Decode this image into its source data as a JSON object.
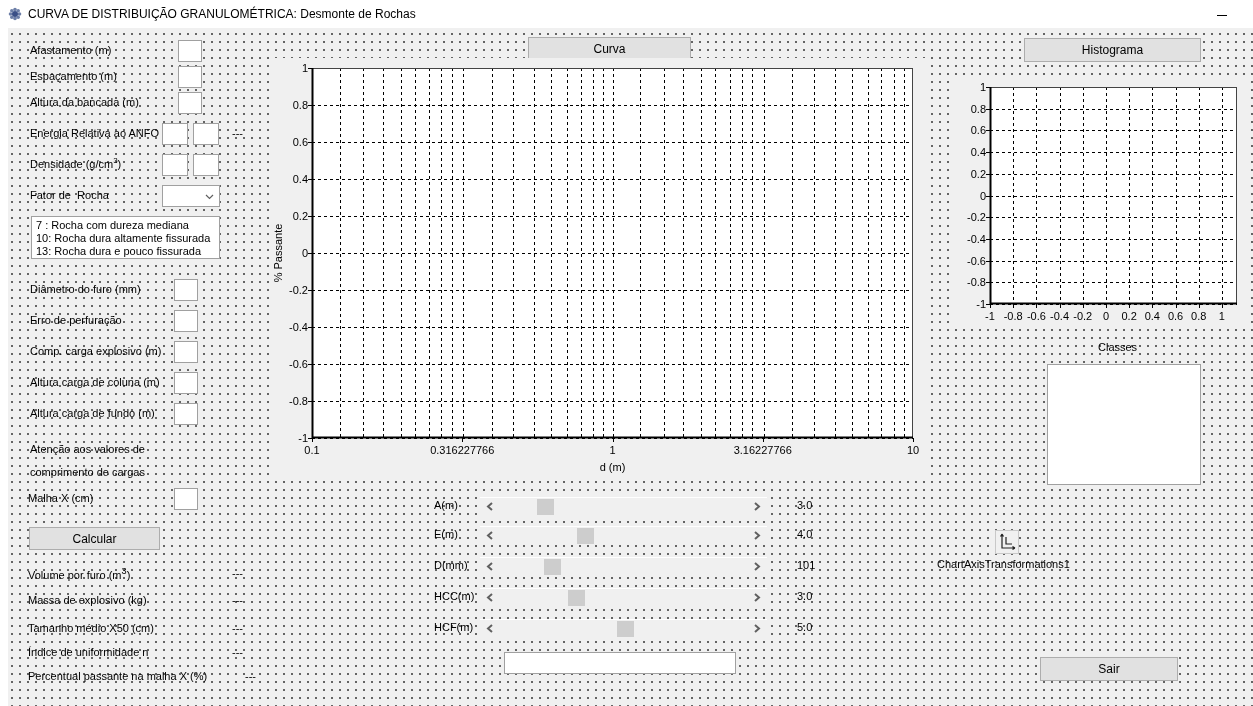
{
  "window": {
    "title": "CURVA DE DISTRIBUIÇÃO GRANULOMÉTRICA: Desmonte de Rochas"
  },
  "inputs": [
    {
      "kind": "single",
      "label": "Afastamento (m)"
    },
    {
      "kind": "single",
      "label": "Espaçamento (m)"
    },
    {
      "kind": "single",
      "label": "Altura da bancada (m)"
    },
    {
      "kind": "double",
      "label": "Energia Relativa ao ANFO",
      "suffix": "---"
    },
    {
      "kind": "double",
      "label": "Densidade (g/cm$^{3}$)"
    },
    {
      "kind": "combo",
      "label": "Fator de  Rocha"
    }
  ],
  "rock_factor_notes": [
    "7 : Rocha com dureza mediana",
    "10: Rocha dura altamente fissurada",
    "13: Rocha dura e pouco fissurada"
  ],
  "charge_inputs": [
    {
      "label": "Diâmetro do furo (mm)"
    },
    {
      "label": "Erro de perfuração"
    },
    {
      "label": "Comp. carga explosivo (m)"
    },
    {
      "label": "Altura carga de coluna (m)"
    },
    {
      "label": "Altura carga de fundo (m)"
    }
  ],
  "warning": [
    "Atenção aos valores de",
    "comprimento de cargas"
  ],
  "mesh": {
    "label": "Malha X (cm)"
  },
  "calculate_button": "Calcular",
  "results": [
    {
      "label": "Volume por furo (m$^{3}$)",
      "value": "---"
    },
    {
      "label": "Massa de explosivo (kg)",
      "value": "---"
    },
    {
      "label": "Tamanho médio X50 (cm)",
      "value": "---"
    },
    {
      "label": "Índice de uniformidade n",
      "value": "---"
    },
    {
      "label": "Percentual passante na malha X (%)",
      "value": "---"
    }
  ],
  "curve_button": "Curva",
  "curve_chart": {
    "xlabel": "d (m)",
    "ylabel": "% Passante",
    "x_tick_labels": [
      "0.1",
      "0.316227766",
      "1",
      "3.16227766",
      "10"
    ],
    "y_tick_labels": [
      "1",
      "0.8",
      "0.6",
      "0.4",
      "0.2",
      "0",
      "-0.2",
      "-0.4",
      "-0.6",
      "-0.8",
      "-1"
    ]
  },
  "sliders": [
    {
      "label": "A(m)",
      "reading": "3.0"
    },
    {
      "label": "E(m)",
      "reading": "4.0"
    },
    {
      "label": "D(mm)",
      "reading": "101"
    },
    {
      "label": "HCC(m)",
      "reading": "3.0"
    },
    {
      "label": "HCF(m)",
      "reading": "5.0"
    }
  ],
  "histogram_button": "Histograma",
  "histogram_chart": {
    "chart_data": {
      "type": "bar",
      "grid": true,
      "xlim": [
        -1,
        1.13
      ],
      "ylim": [
        -1,
        1
      ],
      "xticks": [
        -1,
        -0.8,
        -0.6,
        -0.4,
        -0.2,
        0,
        0.2,
        0.4,
        0.6,
        0.8,
        1
      ],
      "yticks": [
        -1,
        -0.8,
        -0.6,
        -0.4,
        -0.2,
        0,
        0.2,
        0.4,
        0.6,
        0.8,
        1
      ]
    }
  },
  "classes": {
    "label": "Classes"
  },
  "component": {
    "name": "ChartAxisTransformations1"
  },
  "exit_button": "Sair"
}
